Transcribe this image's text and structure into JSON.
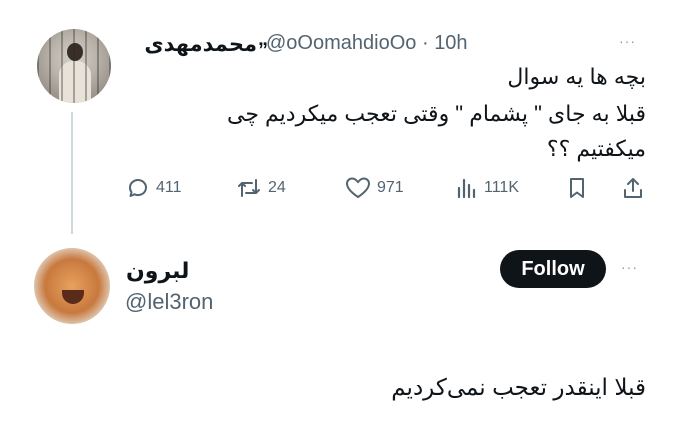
{
  "tweet": {
    "author_name": "محمدمهدی",
    "author_badge": "„",
    "handle": "@oOomahdioOo",
    "separator": "·",
    "time": "10h",
    "more": "···",
    "lines": [
      "بچه ها یه سوال",
      "قبلا به جای \" پشمام \" وقتی تعجب میکردیم چی",
      "میکفتیم ؟؟"
    ],
    "actions": {
      "replies": "411",
      "reposts": "24",
      "likes": "971",
      "views": "111K"
    }
  },
  "reply": {
    "author_name": "لبرون",
    "handle": "@lel3ron",
    "follow_label": "Follow",
    "more": "···",
    "text": "قبلا اینقدر تعجب نمی‌کردیم"
  },
  "colors": {
    "text": "#0f1419",
    "secondary": "#536471",
    "follow_bg": "#0f1419",
    "thread_line": "#cfd9de"
  }
}
